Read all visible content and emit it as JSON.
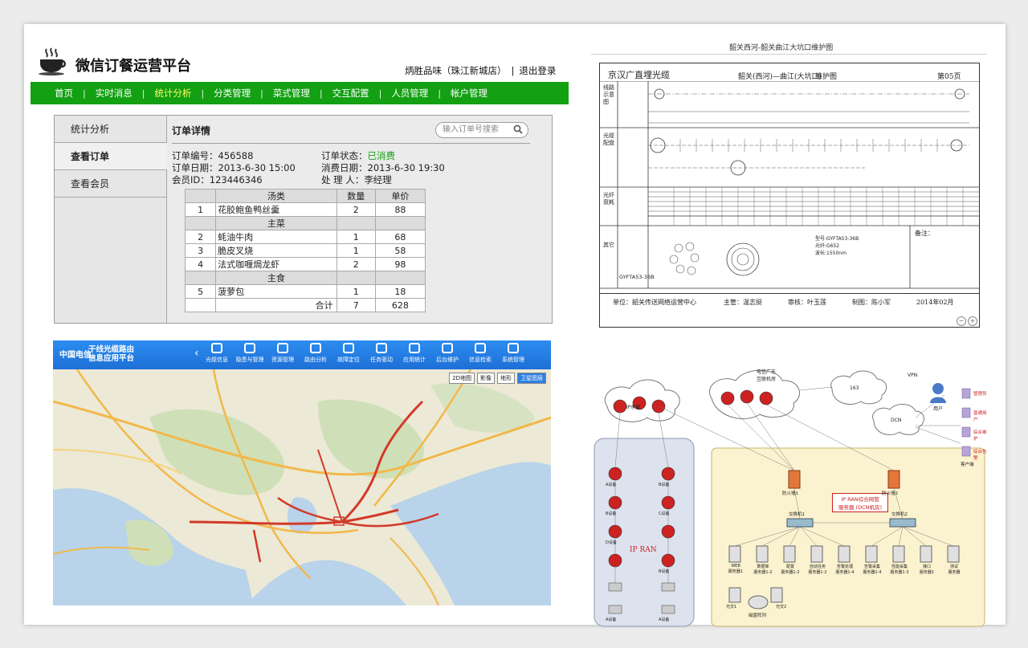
{
  "app": {
    "title": "微信订餐运营平台",
    "store": "炳胜品味（珠江新城店）",
    "divider": "|",
    "logout": "退出登录"
  },
  "nav": [
    "首页",
    "实时消息",
    "统计分析",
    "分类管理",
    "菜式管理",
    "交互配置",
    "人员管理",
    "帐户管理"
  ],
  "nav_active": "统计分析",
  "sidebar": [
    "统计分析",
    "查看订单",
    "查看会员"
  ],
  "order": {
    "title": "订单详情",
    "search_placeholder": "输入订单号搜索",
    "number_label": "订单编号：",
    "number": "456588",
    "status_label": "订单状态：",
    "status": "已消费",
    "date_label": "订单日期：",
    "date": "2013-6-30 15:00",
    "consume_label": "消费日期：",
    "consume_date": "2013-6-30 19:30",
    "member_label": "会员ID：",
    "member_id": "123446346",
    "handler_label": "处 理 人：",
    "handler": "李经理",
    "headers": [
      "汤类",
      "数量",
      "单价"
    ],
    "rows": [
      {
        "no": "1",
        "name": "花胶鲍鱼鸭丝羹",
        "qty": "2",
        "price": "88"
      },
      {
        "category": "主菜"
      },
      {
        "no": "2",
        "name": "蚝油牛肉",
        "qty": "1",
        "price": "68"
      },
      {
        "no": "3",
        "name": "脆皮叉烧",
        "qty": "1",
        "price": "58"
      },
      {
        "no": "4",
        "name": "法式咖喱焗龙虾",
        "qty": "2",
        "price": "98"
      },
      {
        "category": "主食"
      },
      {
        "no": "5",
        "name": "菠萝包",
        "qty": "1",
        "price": "18"
      }
    ],
    "total_label": "合计",
    "total_qty": "7",
    "total_price": "628"
  },
  "map": {
    "logo": "中国电信",
    "title_line1": "干线光缆路由",
    "title_line2": "信息应用平台",
    "back": "‹",
    "toolbar": [
      "光缆信息",
      "隐患与管理",
      "资源管理",
      "路由分析",
      "故障定位",
      "任务驱动",
      "应用统计",
      "后台维护",
      "信息检索",
      "系统管理"
    ],
    "switch": [
      "2D地图",
      "影像",
      "地形",
      "卫星图层"
    ]
  },
  "cable": {
    "caption": "韶关西河-韶关曲江大坑口维护图",
    "title": "京汉广直埋光缆",
    "route": "韶关(西河)—曲江(大坑口)",
    "kind": "维护图",
    "page": "第05页",
    "sections": [
      "线路示意图",
      "光缆配盘",
      "光纤衰耗",
      "其它"
    ],
    "model": "GYFTA53-36B",
    "specs": [
      "型号:GYFTA53-36B",
      "光纤:G652",
      "波长:1550nm"
    ],
    "remark": "备注：",
    "footer": {
      "unit": "单位：韶关传送网络运营中心",
      "owner": "主管：温志挺",
      "auditor": "审核：叶玉莲",
      "drafter": "制图：陈小军",
      "date": "2014年02月"
    }
  },
  "network": {
    "clouds": [
      "IP承载",
      "电信广东\n互联机房",
      "163",
      "DCN"
    ],
    "left_group": "IP RAN",
    "right_group": "IP RAN综合网管\n服务器 (DCN机房)",
    "firewalls": [
      "防火墙1",
      "防火墙2"
    ],
    "switches": [
      "交换机1",
      "交换机2"
    ],
    "servers": [
      "WEB\n服务器1",
      "数据库\n服务器1-2",
      "配置\n服务器1-2",
      "自动任务\n服务器1-2",
      "告警处理\n服务器1-4",
      "告警采集\n服务器1-4",
      "性能采集\n服务器1-3",
      "接口\n服务器1",
      "测试\n服务器"
    ],
    "storage": "磁盘阵列",
    "storage_nodes": [
      "光交1",
      "光交2"
    ],
    "right_users": [
      "管理员",
      "普通用户",
      "综合维护",
      "综合告警"
    ],
    "clients": "客户端",
    "vpn": "VPN",
    "user": "用户",
    "devices_left": [
      "A设备",
      "B设备",
      "B设备",
      "C设备",
      "D设备",
      "B设备",
      "A设备",
      "A设备"
    ]
  }
}
